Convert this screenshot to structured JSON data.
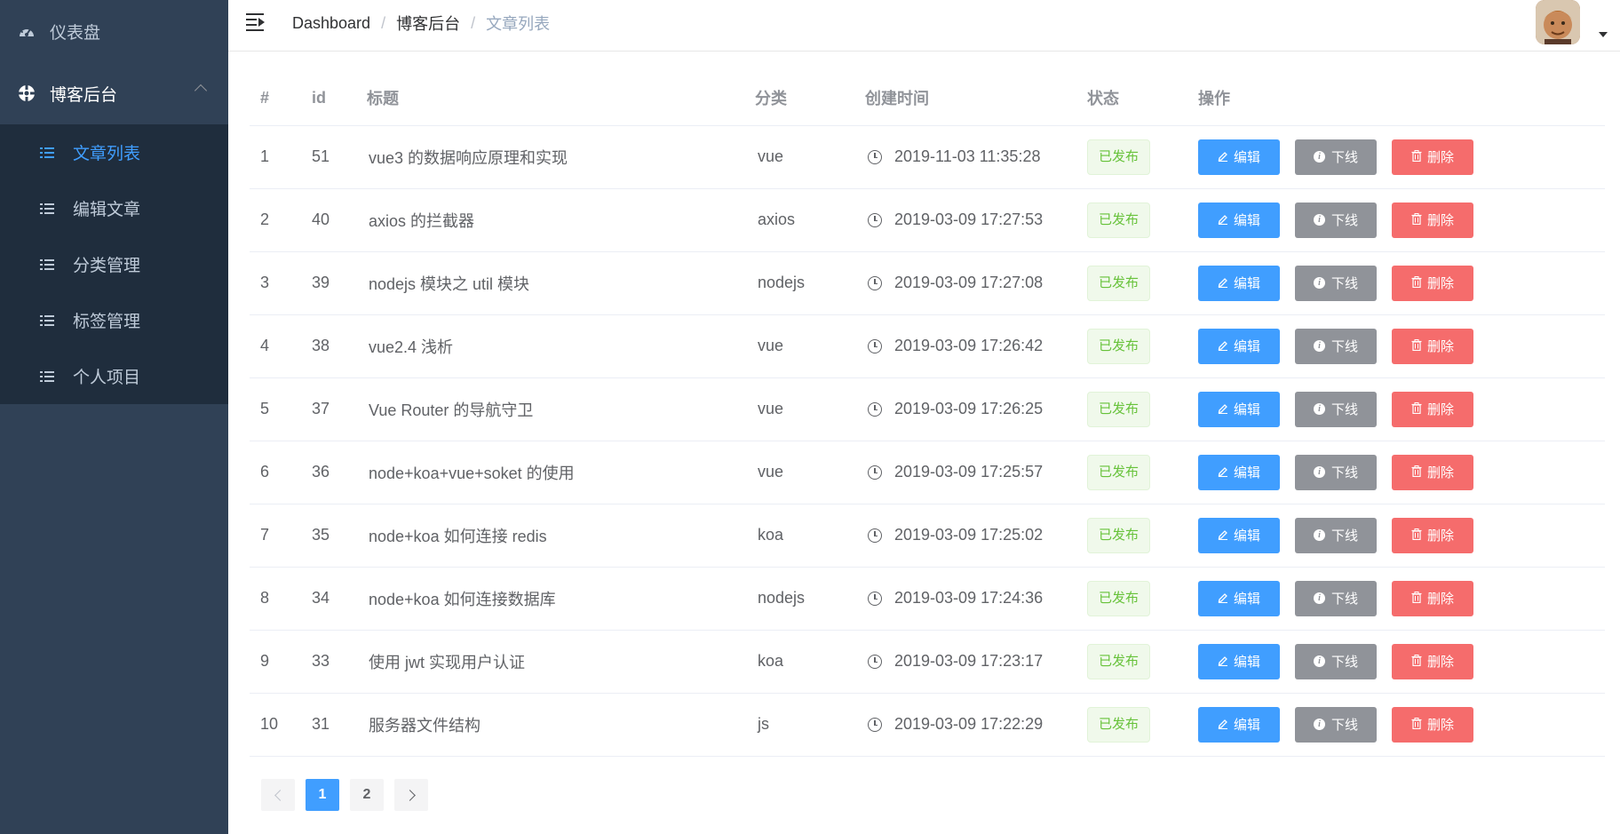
{
  "sidebar": {
    "dashboard_label": "仪表盘",
    "blog_label": "博客后台",
    "sub_items": [
      {
        "label": "文章列表",
        "active": true
      },
      {
        "label": "编辑文章",
        "active": false
      },
      {
        "label": "分类管理",
        "active": false
      },
      {
        "label": "标签管理",
        "active": false
      },
      {
        "label": "个人项目",
        "active": false
      }
    ]
  },
  "header": {
    "breadcrumb": [
      "Dashboard",
      "博客后台",
      "文章列表"
    ],
    "separator": "/"
  },
  "table": {
    "columns": [
      "#",
      "id",
      "标题",
      "分类",
      "创建时间",
      "状态",
      "操作"
    ],
    "rows": [
      {
        "index": "1",
        "id": "51",
        "title": "vue3 的数据响应原理和实现",
        "category": "vue",
        "created": "2019-11-03 11:35:28",
        "status": "已发布"
      },
      {
        "index": "2",
        "id": "40",
        "title": "axios 的拦截器",
        "category": "axios",
        "created": "2019-03-09 17:27:53",
        "status": "已发布"
      },
      {
        "index": "3",
        "id": "39",
        "title": "nodejs 模块之 util 模块",
        "category": "nodejs",
        "created": "2019-03-09 17:27:08",
        "status": "已发布"
      },
      {
        "index": "4",
        "id": "38",
        "title": "vue2.4 浅析",
        "category": "vue",
        "created": "2019-03-09 17:26:42",
        "status": "已发布"
      },
      {
        "index": "5",
        "id": "37",
        "title": "Vue Router 的导航守卫",
        "category": "vue",
        "created": "2019-03-09 17:26:25",
        "status": "已发布"
      },
      {
        "index": "6",
        "id": "36",
        "title": "node+koa+vue+soket 的使用",
        "category": "vue",
        "created": "2019-03-09 17:25:57",
        "status": "已发布"
      },
      {
        "index": "7",
        "id": "35",
        "title": "node+koa 如何连接 redis",
        "category": "koa",
        "created": "2019-03-09 17:25:02",
        "status": "已发布"
      },
      {
        "index": "8",
        "id": "34",
        "title": "node+koa 如何连接数据库",
        "category": "nodejs",
        "created": "2019-03-09 17:24:36",
        "status": "已发布"
      },
      {
        "index": "9",
        "id": "33",
        "title": "使用 jwt 实现用户认证",
        "category": "koa",
        "created": "2019-03-09 17:23:17",
        "status": "已发布"
      },
      {
        "index": "10",
        "id": "31",
        "title": "服务器文件结构",
        "category": "js",
        "created": "2019-03-09 17:22:29",
        "status": "已发布"
      }
    ],
    "actions": {
      "edit": "编辑",
      "offline": "下线",
      "delete": "删除"
    }
  },
  "pagination": {
    "pages": [
      "1",
      "2"
    ],
    "current": "1"
  },
  "colors": {
    "sidebar_bg": "#304156",
    "submenu_bg": "#1f2d3d",
    "primary": "#409eff",
    "info": "#909399",
    "danger": "#f56c6c",
    "success": "#67c23a"
  }
}
